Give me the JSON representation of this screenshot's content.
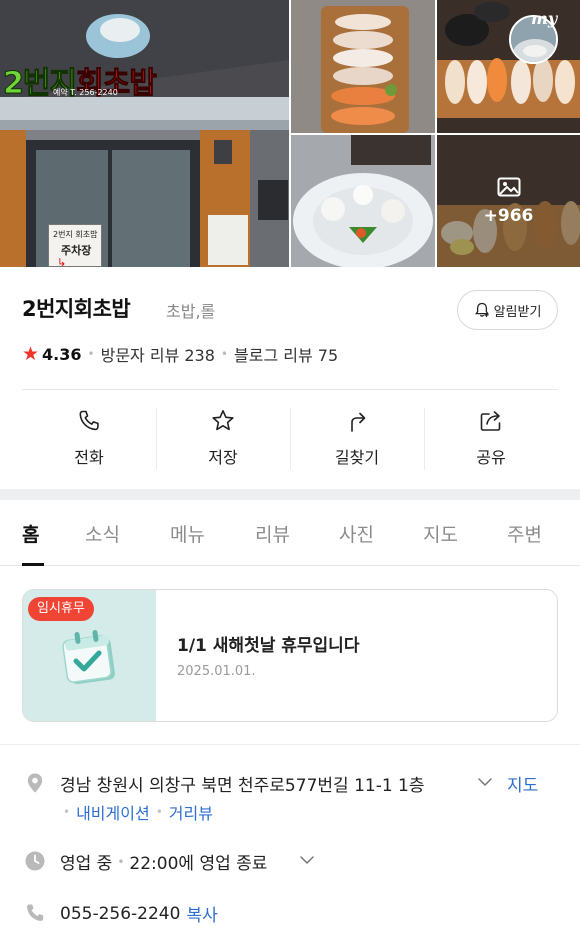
{
  "photos": {
    "sign_text_green": "2번지",
    "sign_text_red": "회초밥",
    "sign_phone": "예약 T. 256-2240",
    "board_line1": "2번지 회초밥",
    "board_line2": "주차장",
    "badge_label": "my",
    "more_count": "+966"
  },
  "place": {
    "name": "2번지회초밥",
    "category": "초밥,롤",
    "alarm_button": "알림받기",
    "rating": "4.36",
    "visitor_reviews": "방문자 리뷰 238",
    "blog_reviews": "블로그 리뷰 75"
  },
  "actions": {
    "call": "전화",
    "save": "저장",
    "directions": "길찾기",
    "share": "공유"
  },
  "tabs": [
    "홈",
    "소식",
    "메뉴",
    "리뷰",
    "사진",
    "지도",
    "주변"
  ],
  "notice": {
    "badge": "임시휴무",
    "title": "1/1 새해첫날 휴무입니다",
    "date": "2025.01.01."
  },
  "info": {
    "address": "경남 창원시 의창구 북면 천주로577번길 11-1 1층",
    "map_link": "지도",
    "navigation_link": "내비게이션",
    "streetview_link": "거리뷰",
    "hours_status": "영업 중",
    "hours_detail": "22:00에 영업 종료",
    "phone": "055-256-2240",
    "copy_link": "복사"
  },
  "colors": {
    "accent_blue": "#2c6fd1",
    "star_red": "#f1332a",
    "badge_red": "#f04434",
    "notice_thumb_bg": "#d4ebe9"
  }
}
